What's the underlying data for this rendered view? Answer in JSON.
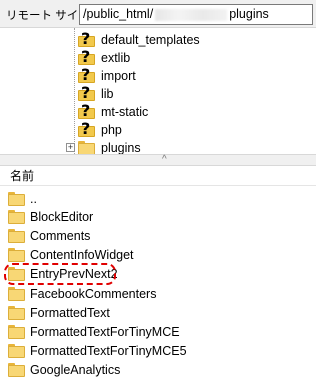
{
  "pathbar": {
    "label": "リモート サイト:",
    "path_prefix": "/public_html/",
    "path_suffix": "plugins"
  },
  "tree": {
    "items": [
      {
        "label": "default_templates",
        "icon": "question-folder-icon"
      },
      {
        "label": "extlib",
        "icon": "question-folder-icon"
      },
      {
        "label": "import",
        "icon": "question-folder-icon"
      },
      {
        "label": "lib",
        "icon": "question-folder-icon"
      },
      {
        "label": "mt-static",
        "icon": "question-folder-icon"
      },
      {
        "label": "php",
        "icon": "question-folder-icon"
      },
      {
        "label": "plugins",
        "icon": "folder-icon",
        "expander": "+"
      }
    ]
  },
  "list": {
    "column_header": "名前",
    "items": [
      {
        "label": ".."
      },
      {
        "label": "BlockEditor"
      },
      {
        "label": "Comments"
      },
      {
        "label": "ContentInfoWidget"
      },
      {
        "label": "EntryPrevNext2",
        "highlighted": true
      },
      {
        "label": "FacebookCommenters"
      },
      {
        "label": "FormattedText"
      },
      {
        "label": "FormattedTextForTinyMCE"
      },
      {
        "label": "FormattedTextForTinyMCE5"
      },
      {
        "label": "GoogleAnalytics"
      }
    ]
  },
  "colors": {
    "folder": "#f8d775",
    "highlight": "#e00000",
    "chrome": "#f0f0f0"
  }
}
